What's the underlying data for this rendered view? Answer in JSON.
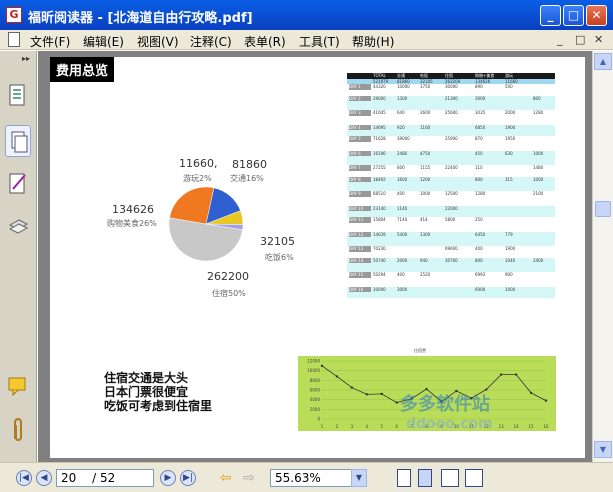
{
  "window": {
    "title": "福昕阅读器 - [北海道自由行攻略.pdf]",
    "app_icon": "G",
    "controls": {
      "minimize": "_",
      "maximize": "□",
      "close": "✕"
    }
  },
  "menubar": {
    "items": [
      "文件(F)",
      "编辑(E)",
      "视图(V)",
      "注释(C)",
      "表单(R)",
      "工具(T)",
      "帮助(H)"
    ],
    "mdi_controls": [
      "_",
      "□",
      "✕"
    ]
  },
  "sidebar": {
    "collapse": "▸▸",
    "icons": [
      "pages-icon",
      "layers-icon",
      "signature-icon",
      "attachments-panel-icon",
      "comments-icon",
      "paperclip-icon"
    ]
  },
  "page": {
    "section_title": "费用总览",
    "pie_labels": [
      {
        "value": "11660,",
        "name": "游玩2%"
      },
      {
        "value": "81860",
        "name": "交通16%"
      },
      {
        "value": "134626",
        "name": "购物美食26%"
      },
      {
        "value": "32105",
        "name": "吃饭6%"
      },
      {
        "value": "262200",
        "name": "住宿50%"
      }
    ],
    "notes": [
      "住宿交通是大头",
      "日本门票很便宜",
      "吃饭可考虑到住宿里"
    ],
    "table_header": [
      "TOTAL",
      "交通",
      "吃饭",
      "住宿",
      "购物+美食",
      "游玩"
    ],
    "table_totals": [
      "521979",
      "81860",
      "32105",
      "262200",
      "134626",
      "11660"
    ],
    "table_rows": [
      [
        "DAY 1",
        "44320",
        "10000",
        "1750",
        "30000",
        "890",
        "500",
        ""
      ],
      [
        "DAY 2",
        "29000",
        "1300",
        "",
        "21300",
        "3000",
        "",
        "800"
      ],
      [
        "DAY 3",
        "41645",
        "640",
        "2600",
        "25600",
        "3035",
        "2000",
        "1280"
      ],
      [
        "DAY 4",
        "14695",
        "920",
        "1160",
        "",
        "6850",
        "1900",
        ""
      ],
      [
        "DAY 5",
        "71628",
        "39000",
        "",
        "25900",
        "870",
        "1950",
        ""
      ],
      [
        "DAY 6",
        "16196",
        "2480",
        "4750",
        "",
        "450",
        "630",
        "1000"
      ],
      [
        "DAY 7",
        "27255",
        "600",
        "1155",
        "22400",
        "110",
        "",
        "1480"
      ],
      [
        "DAY 8",
        "18492",
        "1600",
        "1200",
        "",
        "800",
        "315",
        "1000"
      ],
      [
        "DAY 9",
        "68510",
        "400",
        "1000",
        "12500",
        "1280",
        "",
        "2100"
      ],
      [
        "DAY 10",
        "23140",
        "1140",
        "",
        "22000",
        "",
        "",
        ""
      ],
      [
        "DAY 11",
        "15804",
        "7140",
        "414",
        "5800",
        "250",
        "",
        ""
      ],
      [
        "DAY 12",
        "14639",
        "5400",
        "1300",
        "",
        "6450",
        "779",
        ""
      ],
      [
        "DAY 13",
        "70230",
        "",
        "",
        "69600",
        "400",
        "1900",
        ""
      ],
      [
        "DAY 14",
        "50740",
        "2000",
        "940",
        "30700",
        "800",
        "1040",
        "2400"
      ],
      [
        "DAY 15",
        "50294",
        "400",
        "2520",
        "",
        "6993",
        "900",
        ""
      ],
      [
        "DAY 16",
        "10000",
        "3000",
        "",
        "",
        "6000",
        "1000",
        ""
      ]
    ],
    "chart_caption": "住宿费",
    "watermark_cn": "多多软件站",
    "watermark_en": "ddooo.com"
  },
  "chart_data": [
    {
      "type": "pie",
      "title": "",
      "labels": [
        "住宿",
        "购物美食",
        "交通",
        "吃饭",
        "游玩"
      ],
      "values": [
        262200,
        134626,
        81860,
        32105,
        11660
      ],
      "percent_labels": [
        "50%",
        "26%",
        "16%",
        "6%",
        "2%"
      ],
      "colors": [
        "#c8c8c8",
        "#f07820",
        "#3060d0",
        "#e8c820",
        "#a0a0e8"
      ]
    },
    {
      "type": "line",
      "title": "",
      "x": [
        1,
        2,
        3,
        4,
        5,
        6,
        7,
        8,
        9,
        10,
        11,
        12,
        13,
        14,
        15,
        16
      ],
      "y": [
        11000,
        8800,
        6500,
        5100,
        5200,
        3400,
        4200,
        6200,
        3600,
        5800,
        4300,
        6100,
        9200,
        9200,
        5400,
        3800
      ],
      "ylim": [
        0,
        12000
      ],
      "grid": true
    }
  ],
  "statusbar": {
    "current_page": "20",
    "page_total": "/ 52",
    "zoom": "55.63%"
  }
}
